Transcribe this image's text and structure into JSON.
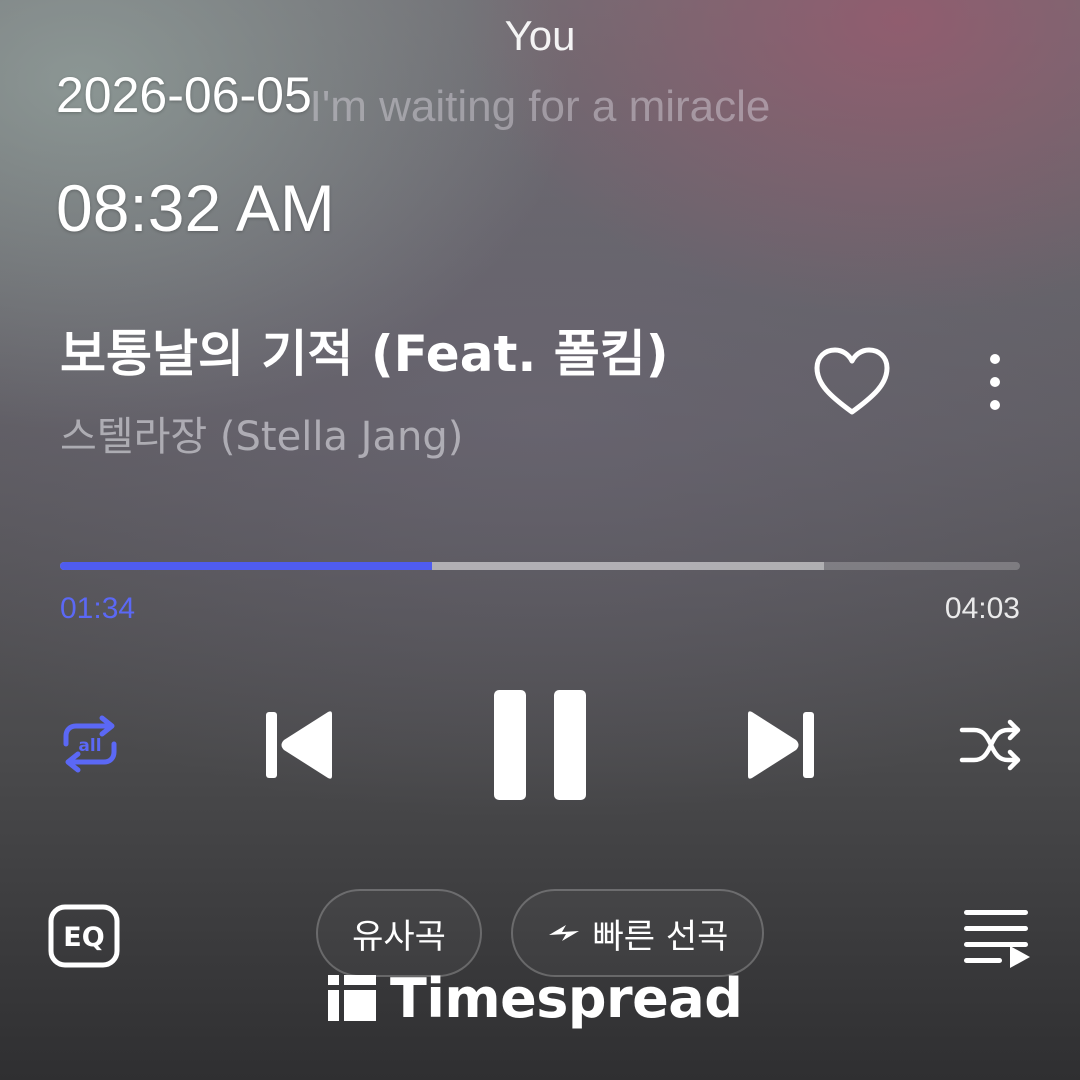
{
  "lyrics": {
    "current": "You",
    "next": "I'm waiting for a miracle"
  },
  "clock": {
    "date": "2026-06-05",
    "time": "08:32 AM"
  },
  "track": {
    "title": "보통날의 기적 (Feat. 폴킴)",
    "artist": "스텔라장 (Stella Jang)",
    "liked": false
  },
  "playback": {
    "elapsed": "01:34",
    "duration": "04:03",
    "progress_fraction": 0.387,
    "buffered_fraction": 0.796,
    "state": "playing",
    "repeat_mode": "all"
  },
  "actions": {
    "similar_label": "유사곡",
    "quick_select_label": "빠른 선곡",
    "eq_label": "EQ"
  },
  "watermark": {
    "text": "Timespread"
  },
  "colors": {
    "accent": "#4f5cf0",
    "elapsed_text": "#5b68f5"
  },
  "icons": {
    "like": "heart-icon",
    "more": "more-vertical-icon",
    "repeat": "repeat-all-icon",
    "previous": "skip-previous-icon",
    "pause": "pause-icon",
    "next": "skip-next-icon",
    "shuffle": "shuffle-icon",
    "eq": "eq-icon",
    "quick": "bolt-icon",
    "queue": "playlist-icon"
  }
}
